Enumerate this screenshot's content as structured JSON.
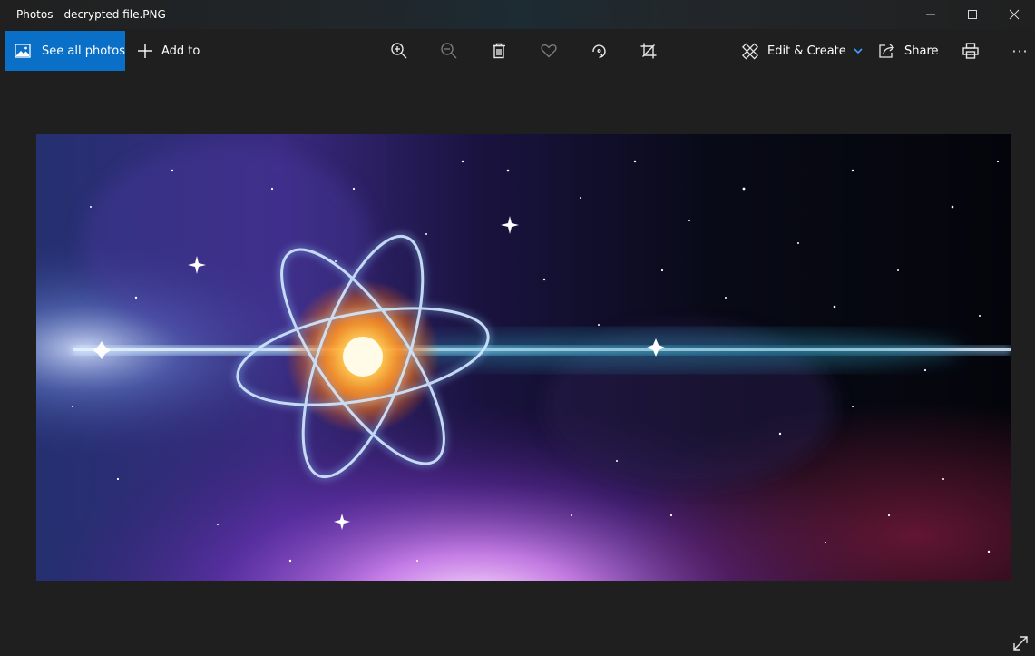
{
  "window": {
    "title": "Photos - decrypted file.PNG"
  },
  "toolbar": {
    "see_all_label": "See all photos",
    "add_to_label": "Add to",
    "edit_create_label": "Edit & Create",
    "share_label": "Share",
    "more_label": "···",
    "icons": [
      "zoom-in-icon",
      "zoom-out-icon",
      "delete-icon",
      "favorite-icon",
      "rotate-icon",
      "crop-icon",
      "print-icon"
    ]
  },
  "photo": {
    "description_colors": [
      "#1a1f5c",
      "#6a2fa0",
      "#ff9a2a",
      "#3fb7d6",
      "#f7c6ff"
    ]
  },
  "colors": {
    "accent": "#0a6fc7",
    "background": "#1f1f1f",
    "chevron": "#3aa0ff"
  }
}
